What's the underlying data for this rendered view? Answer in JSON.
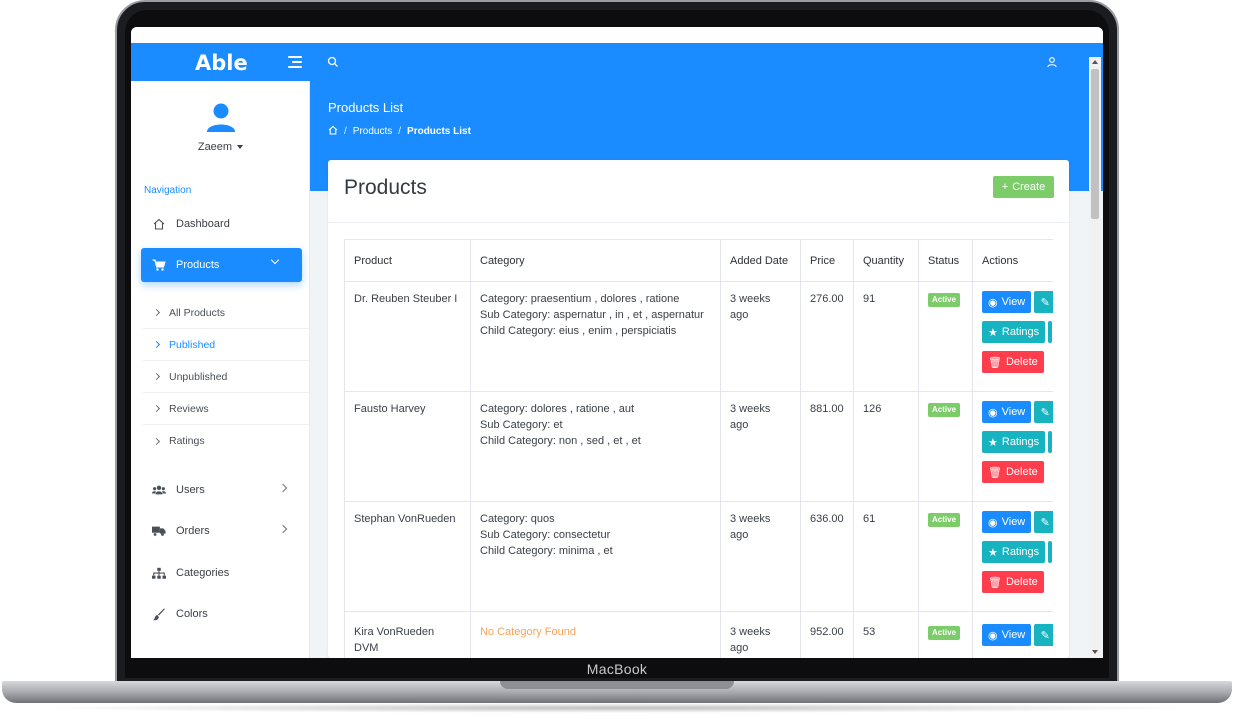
{
  "device": {
    "label": "MacBook"
  },
  "colors": {
    "primary": "#1a8cff",
    "success": "#7ccc6a",
    "info": "#17b3c1",
    "danger": "#ff3d4c",
    "warning_text": "#f4a259"
  },
  "navbar": {
    "brand": "Able",
    "icons": [
      "menu-icon",
      "search-icon",
      "user-icon"
    ]
  },
  "sidebar": {
    "user_name": "Zaeem",
    "heading": "Navigation",
    "items": [
      {
        "label": "Dashboard",
        "icon": "home-icon"
      },
      {
        "label": "Products",
        "icon": "cart-icon",
        "active": true
      },
      {
        "label": "Users",
        "icon": "users-icon"
      },
      {
        "label": "Orders",
        "icon": "truck-icon"
      },
      {
        "label": "Categories",
        "icon": "sitemap-icon"
      },
      {
        "label": "Colors",
        "icon": "brush-icon"
      }
    ],
    "sub_items": [
      {
        "label": "All Products"
      },
      {
        "label": "Published",
        "current": true
      },
      {
        "label": "Unpublished"
      },
      {
        "label": "Reviews"
      },
      {
        "label": "Ratings"
      }
    ]
  },
  "page_header": {
    "title": "Products List",
    "breadcrumb": [
      "Products",
      "Products List"
    ]
  },
  "card": {
    "title": "Products",
    "create_label": "Create"
  },
  "table": {
    "headers": [
      "Product",
      "Category",
      "Added Date",
      "Price",
      "Quantity",
      "Status",
      "Actions"
    ],
    "rows": [
      {
        "product": "Dr. Reuben Steuber I",
        "category": "Category: praesentium , dolores , ratione",
        "sub_category": "Sub Category: aspernatur , in , et , aspernatur",
        "child_category": "Child Category: eius , enim , perspiciatis",
        "added": "3 weeks ago",
        "price": "276.00",
        "quantity": "91",
        "status": "Active"
      },
      {
        "product": "Fausto Harvey",
        "category": "Category: dolores , ratione , aut",
        "sub_category": "Sub Category: et",
        "child_category": "Child Category: non , sed , et , et",
        "added": "3 weeks ago",
        "price": "881.00",
        "quantity": "126",
        "status": "Active"
      },
      {
        "product": "Stephan VonRueden",
        "category": "Category: quos",
        "sub_category": "Sub Category: consectetur",
        "child_category": "Child Category: minima , et",
        "added": "3 weeks ago",
        "price": "636.00",
        "quantity": "61",
        "status": "Active"
      },
      {
        "product": "Kira VonRueden DVM",
        "category": "No Category Found",
        "added": "3 weeks ago",
        "price": "952.00",
        "quantity": "53",
        "status": "Active"
      }
    ],
    "action_labels": {
      "view": "View",
      "ratings": "Ratings",
      "delete": "Delete"
    }
  }
}
